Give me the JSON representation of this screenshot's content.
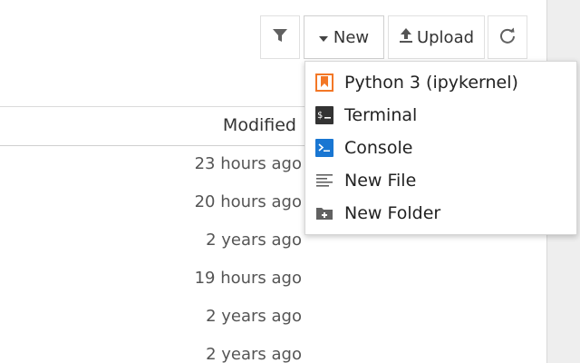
{
  "toolbar": {
    "filter_icon": "filter-icon",
    "new_label": "New",
    "upload_label": "Upload",
    "refresh_icon": "refresh-icon"
  },
  "table": {
    "modified_header": "Modified",
    "rows": [
      {
        "modified": "23 hours ago"
      },
      {
        "modified": "20 hours ago"
      },
      {
        "modified": "2 years ago"
      },
      {
        "modified": "19 hours ago"
      },
      {
        "modified": "2 years ago"
      },
      {
        "modified": "2 years ago"
      }
    ]
  },
  "new_menu": {
    "items": [
      {
        "label": "Python 3 (ipykernel)",
        "icon": "python-notebook-icon"
      },
      {
        "label": "Terminal",
        "icon": "terminal-icon"
      },
      {
        "label": "Console",
        "icon": "console-icon"
      },
      {
        "label": "New File",
        "icon": "text-file-icon"
      },
      {
        "label": "New Folder",
        "icon": "new-folder-icon"
      }
    ]
  },
  "colors": {
    "notebook_orange": "#f37726",
    "console_blue": "#1976d2",
    "terminal_dark": "#333333"
  }
}
